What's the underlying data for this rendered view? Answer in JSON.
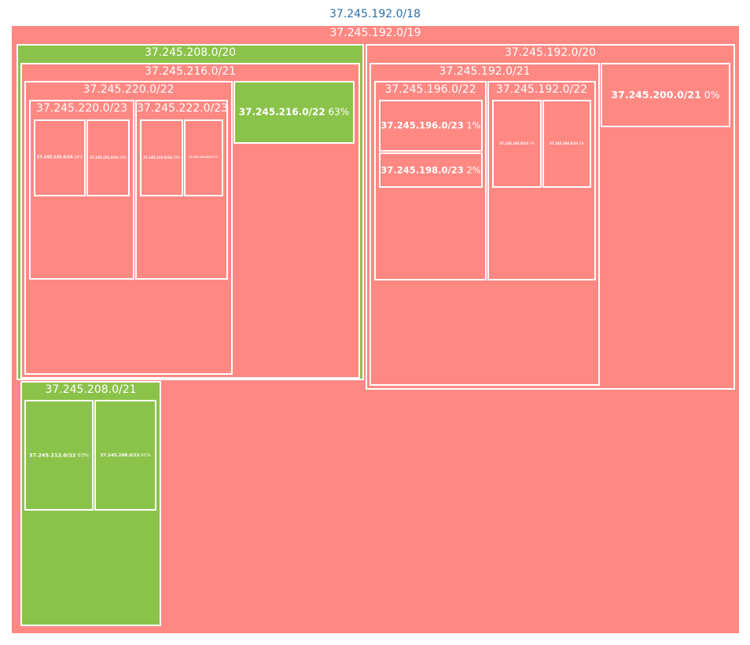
{
  "colors": {
    "red": "#ff8883",
    "green": "#8bc34a",
    "border": "#ffffff",
    "root_text": "#2a6fa8"
  },
  "chart_data": {
    "type": "treemap",
    "root": "37.245.192.0/18",
    "nodes": [
      {
        "id": "n19",
        "label": "37.245.192.0/19",
        "parent": "root",
        "color": "red"
      },
      {
        "id": "n208_20",
        "label": "37.245.208.0/20",
        "parent": "n19",
        "color": "green"
      },
      {
        "id": "n216_21",
        "label": "37.245.216.0/21",
        "parent": "n208_20",
        "color": "red"
      },
      {
        "id": "n220_22",
        "label": "37.245.220.0/22",
        "parent": "n216_21",
        "color": "red"
      },
      {
        "id": "n220_23",
        "label": "37.245.220.0/23",
        "parent": "n220_22",
        "color": "red"
      },
      {
        "id": "n220_24",
        "label": "37.245.220.0/24",
        "pct": "26%",
        "parent": "n220_23",
        "color": "red"
      },
      {
        "id": "n221_24",
        "label": "37.245.221.0/24",
        "pct": "20%",
        "parent": "n220_23",
        "color": "red"
      },
      {
        "id": "n222_23",
        "label": "37.245.222.0/23",
        "parent": "n220_22",
        "color": "red"
      },
      {
        "id": "n222_24",
        "label": "37.245.222.0/24",
        "pct": "29%",
        "parent": "n222_23",
        "color": "red"
      },
      {
        "id": "n223_24",
        "label": "37.245.223.0/24",
        "pct": "31%",
        "parent": "n222_23",
        "color": "red"
      },
      {
        "id": "n216_22",
        "label": "37.245.216.0/22",
        "pct": "63%",
        "parent": "n216_21",
        "color": "green"
      },
      {
        "id": "n208_21",
        "label": "37.245.208.0/21",
        "parent": "n208_20",
        "color": "green"
      },
      {
        "id": "n212_22",
        "label": "37.245.212.0/22",
        "pct": "63%",
        "parent": "n208_21",
        "color": "green"
      },
      {
        "id": "n208_22",
        "label": "37.245.208.0/22",
        "pct": "61%",
        "parent": "n208_21",
        "color": "green"
      },
      {
        "id": "n192_20",
        "label": "37.245.192.0/20",
        "parent": "n19",
        "color": "red"
      },
      {
        "id": "n192_21",
        "label": "37.245.192.0/21",
        "parent": "n192_20",
        "color": "red"
      },
      {
        "id": "n196_22",
        "label": "37.245.196.0/22",
        "parent": "n192_21",
        "color": "red"
      },
      {
        "id": "n196_23",
        "label": "37.245.196.0/23",
        "pct": "1%",
        "parent": "n196_22",
        "color": "red"
      },
      {
        "id": "n198_23",
        "label": "37.245.198.0/23",
        "pct": "2%",
        "parent": "n196_22",
        "color": "red"
      },
      {
        "id": "n192_22",
        "label": "37.245.192.0/22",
        "parent": "n192_21",
        "color": "red"
      },
      {
        "id": "n192_23",
        "label": "37.245.192.0/23",
        "pct": "1%",
        "parent": "n192_22",
        "color": "red"
      },
      {
        "id": "n194_23",
        "label": "37.245.194.0/23",
        "pct": "2%",
        "parent": "n192_22",
        "color": "red"
      },
      {
        "id": "n200_21",
        "label": "37.245.200.0/21",
        "pct": "0%",
        "parent": "n192_20",
        "color": "red"
      }
    ]
  }
}
